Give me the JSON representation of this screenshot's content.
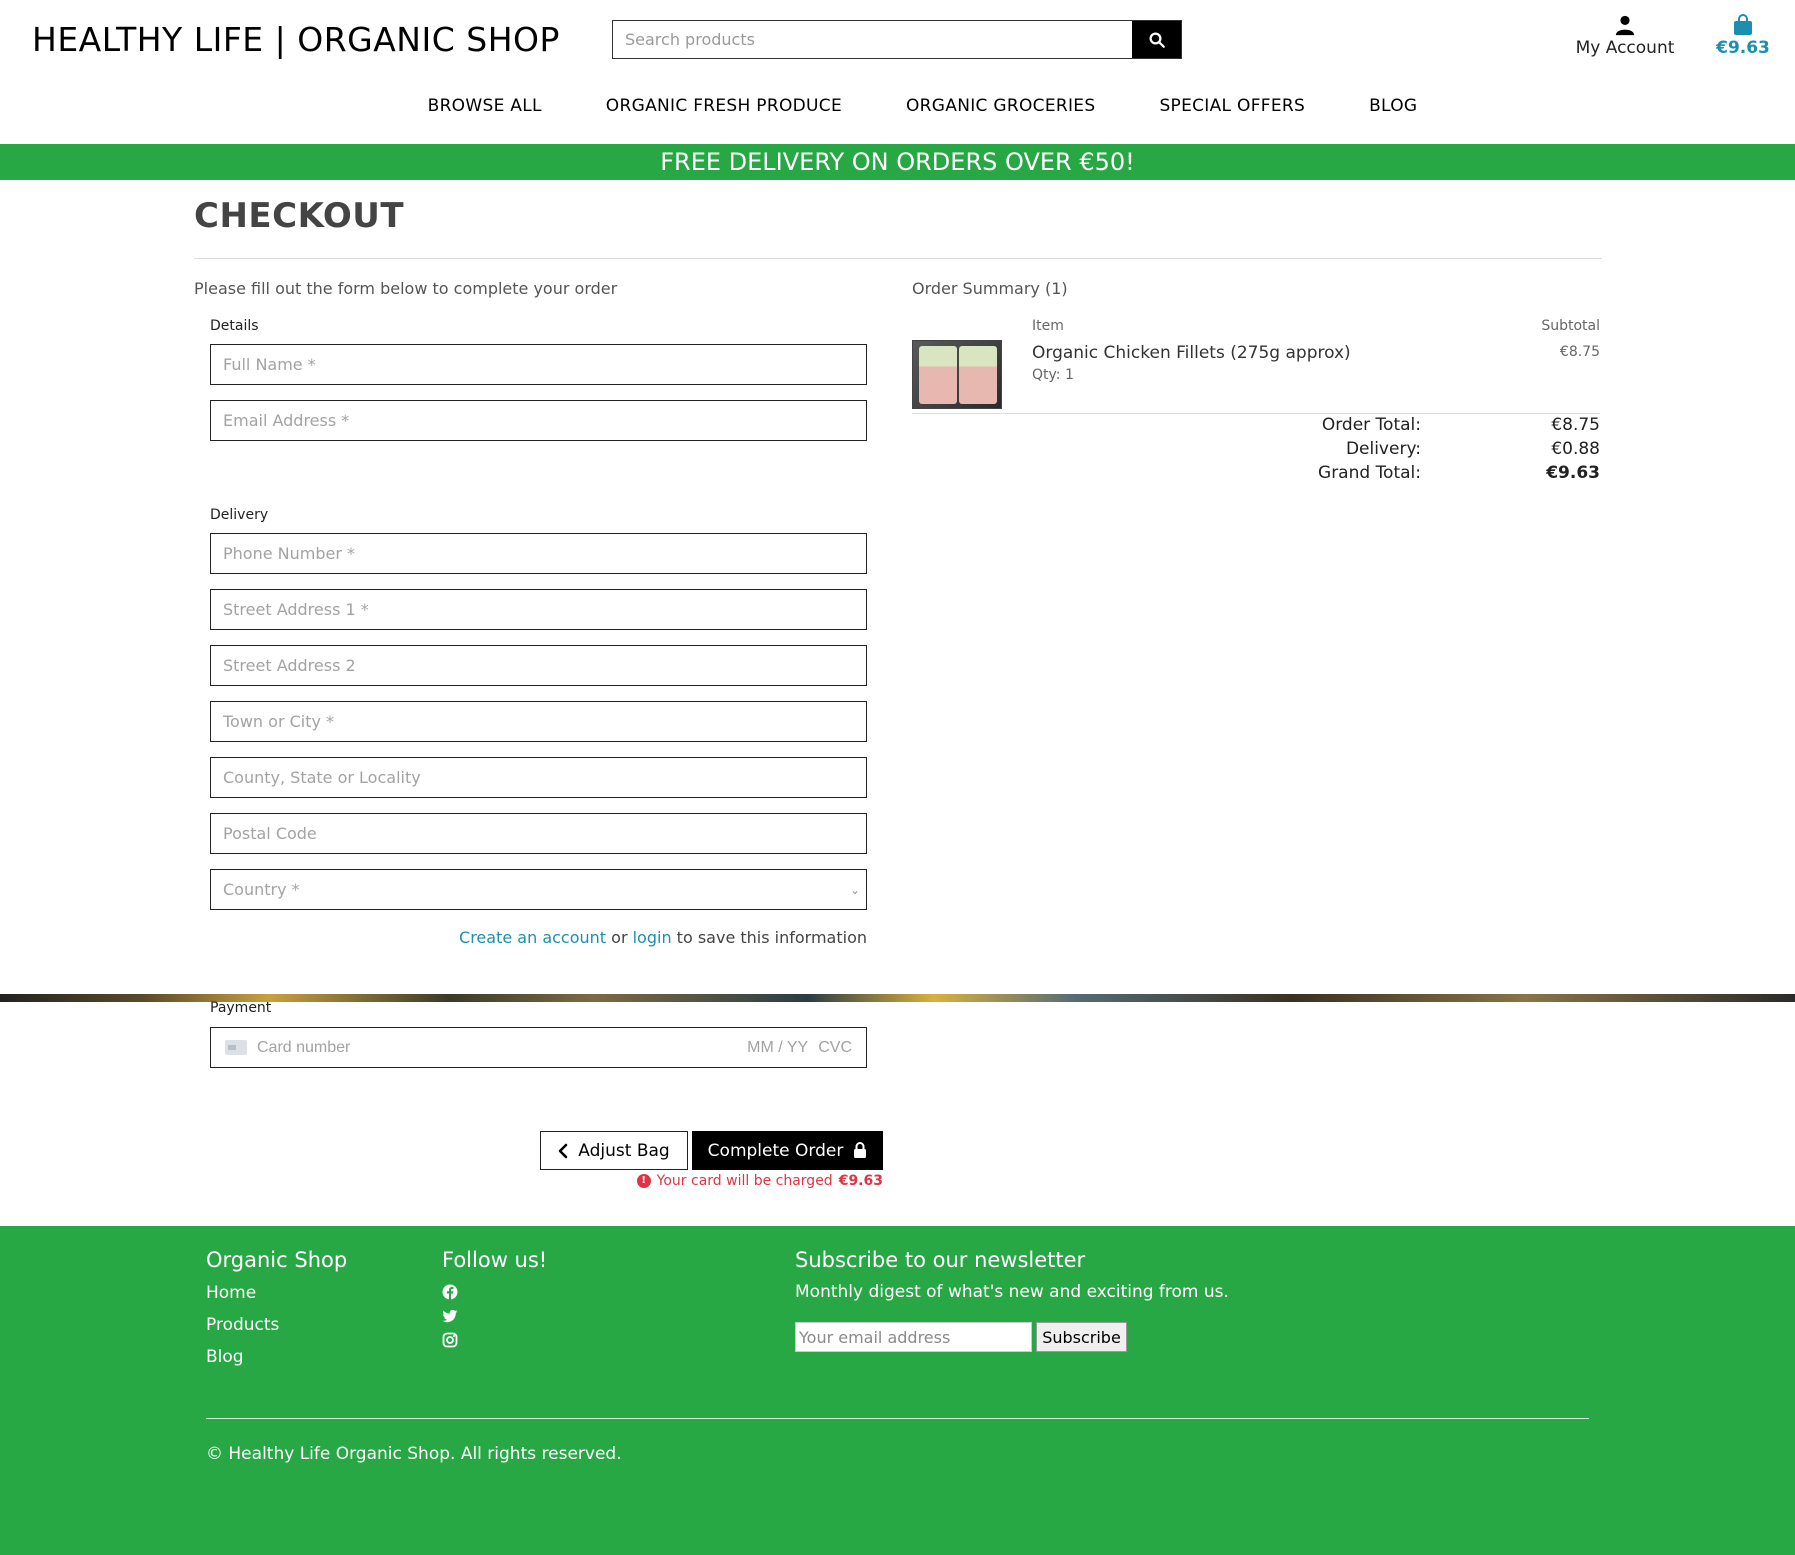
{
  "header": {
    "brand": "HEALTHY LIFE | ORGANIC SHOP",
    "search_placeholder": "Search products",
    "account_label": "My Account",
    "bag_total": "€9.63"
  },
  "nav": {
    "items": [
      "BROWSE ALL",
      "ORGANIC FRESH PRODUCE",
      "ORGANIC GROCERIES",
      "SPECIAL OFFERS",
      "BLOG"
    ]
  },
  "banner": "FREE DELIVERY ON ORDERS OVER €50!",
  "checkout": {
    "title": "CHECKOUT",
    "intro": "Please fill out the form below to complete your order",
    "details_label": "Details",
    "full_name_placeholder": "Full Name *",
    "email_placeholder": "Email Address *",
    "delivery_label": "Delivery",
    "phone_placeholder": "Phone Number *",
    "street1_placeholder": "Street Address 1 *",
    "street2_placeholder": "Street Address 2",
    "town_placeholder": "Town or City *",
    "county_placeholder": "County, State or Locality",
    "postal_placeholder": "Postal Code",
    "country_placeholder": "Country *",
    "save_info": {
      "create_account": "Create an account",
      "or": " or ",
      "login": "login",
      "suffix": " to save this information"
    },
    "payment_label": "Payment",
    "card_number_placeholder": "Card number",
    "card_expiry_placeholder": "MM / YY",
    "card_cvc_placeholder": "CVC",
    "adjust_bag": "Adjust Bag",
    "complete_order": "Complete Order",
    "charge_note": "Your card will be charged",
    "charge_amount": "€9.63"
  },
  "summary": {
    "title": "Order Summary (1)",
    "col_item": "Item",
    "col_subtotal": "Subtotal",
    "items": [
      {
        "name": "Organic Chicken Fillets (275g approx)",
        "qty": "Qty: 1",
        "subtotal": "€8.75"
      }
    ],
    "order_total_label": "Order Total:",
    "order_total": "€8.75",
    "delivery_label": "Delivery:",
    "delivery": "€0.88",
    "grand_total_label": "Grand Total:",
    "grand_total": "€9.63"
  },
  "footer": {
    "shop_heading": "Organic Shop",
    "links": [
      "Home",
      "Products",
      "Blog"
    ],
    "follow_heading": "Follow us!",
    "social_icons": [
      "facebook-icon",
      "twitter-icon",
      "instagram-icon"
    ],
    "newsletter_heading": "Subscribe to our newsletter",
    "newsletter_desc": "Monthly digest of what's new and exciting from us.",
    "email_placeholder": "Your email address",
    "subscribe_label": "Subscribe",
    "copyright": "© Healthy Life Organic Shop. All rights reserved."
  },
  "colors": {
    "brand_green": "#28a745",
    "link_blue": "#1a8fb0",
    "danger": "#dc3545"
  }
}
